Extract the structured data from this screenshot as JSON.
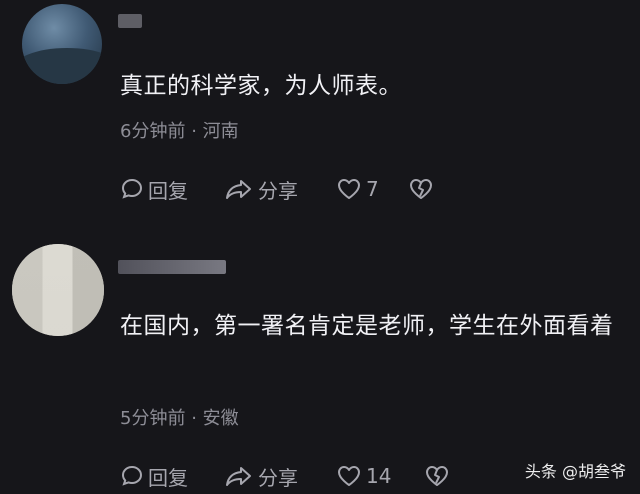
{
  "comments": [
    {
      "text": "真正的科学家，为人师表。",
      "time": "6分钟前",
      "separator": "·",
      "location": "河南",
      "reply_label": "回复",
      "share_label": "分享",
      "likes": "7"
    },
    {
      "text": "在国内，第一署名肯定是老师，学生在外面看着",
      "time": "5分钟前",
      "separator": "·",
      "location": "安徽",
      "reply_label": "回复",
      "share_label": "分享",
      "likes": "14"
    }
  ],
  "watermark": "头条 @胡叁爷",
  "icons": {
    "reply": "comment-bubble-icon",
    "share": "share-arrow-icon",
    "like": "heart-icon",
    "dislike": "broken-heart-icon"
  },
  "colors": {
    "background": "#16161a",
    "text": "#f1f1f5",
    "meta": "#8d8d96",
    "action": "#a6a6ae"
  }
}
